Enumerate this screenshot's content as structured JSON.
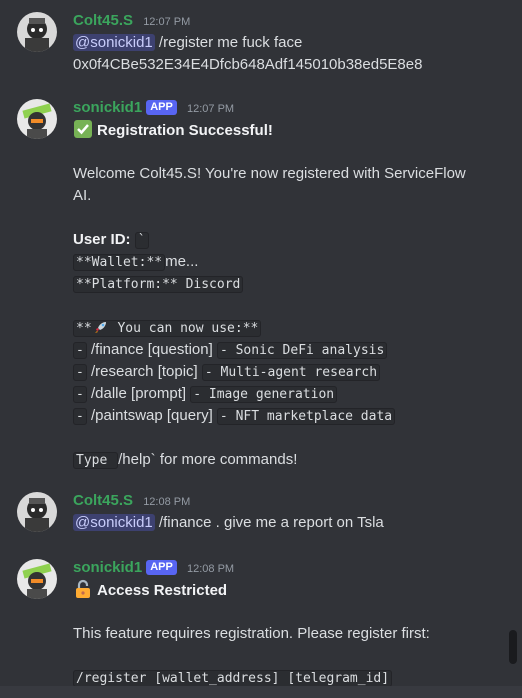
{
  "messages": [
    {
      "author": "Colt45.S",
      "time": "12:07 PM",
      "mention": "@sonickid1",
      "text_after_mention": " /register me fuck face",
      "line2": "0x0f4CBe532E34E4Dfcb648Adf145010b38ed5E8e8"
    },
    {
      "author": "sonickid1",
      "badge": "APP",
      "time": "12:07 PM",
      "title": "Registration Successful!",
      "welcome_line1": "Welcome Colt45.S! You're now registered with ServiceFlow",
      "welcome_line2": "AI.",
      "userid_label": "User ID:",
      "userid_code": "`",
      "wallet_code": "**Wallet:**",
      "wallet_rest": "me...",
      "platform_code": "**Platform:** Discord",
      "use_code_pre": "**",
      "use_code_post": " You can now use:**",
      "commands": [
        {
          "dash": "-",
          "cmd": "/finance [question]",
          "desc": " - Sonic DeFi analysis"
        },
        {
          "dash": "-",
          "cmd": "/research [topic]",
          "desc": " - Multi-agent research"
        },
        {
          "dash": "-",
          "cmd": "/dalle [prompt]",
          "desc": " - Image generation "
        },
        {
          "dash": "-",
          "cmd": "/paintswap [query]",
          "desc": " - NFT marketplace data"
        }
      ],
      "type_code": "Type ",
      "type_rest": "/help` for more commands!"
    },
    {
      "author": "Colt45.S",
      "time": "12:08 PM",
      "mention": "@sonickid1",
      "text_after_mention": " /finance . give me a report on Tsla"
    },
    {
      "author": "sonickid1",
      "badge": "APP",
      "time": "12:08 PM",
      "title": "Access Restricted",
      "body": "This feature requires registration. Please register first:",
      "register_code": "/register [wallet_address] [telegram_id]"
    }
  ],
  "colors": {
    "background": "#313338",
    "username": "#3ba55d",
    "badge": "#5865f2",
    "mention_bg": "#3c4270"
  },
  "icons": [
    "check-mark-emoji",
    "rocket-emoji",
    "lock-emoji"
  ]
}
